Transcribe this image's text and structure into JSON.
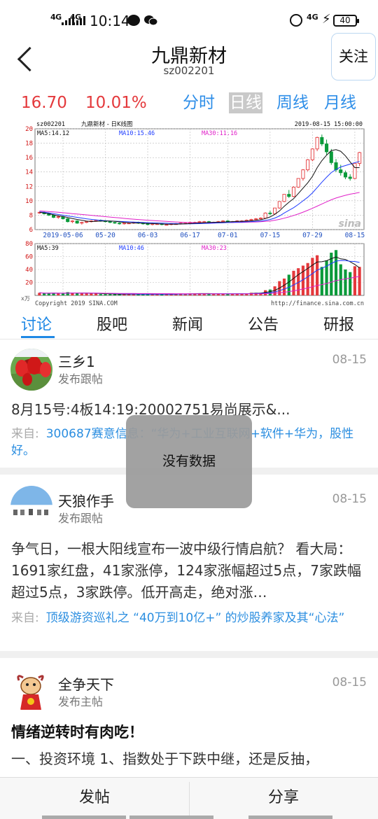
{
  "status_bar": {
    "net1": "4G",
    "net2": "4G",
    "time": "10:14",
    "net3": "4G",
    "battery": "40"
  },
  "header": {
    "title": "九鼎新材",
    "code": "sz002201",
    "follow_label": "关注"
  },
  "quote": {
    "price": "16.70",
    "change_pct": "10.01%",
    "periods": [
      "分时",
      "日线",
      "周线",
      "月线"
    ],
    "active_period": "日线"
  },
  "chart_data": {
    "type": "candlestick",
    "header_code": "sz002201",
    "header_title": "九鼎新材 - 日K线图",
    "header_time": "2019-08-15 15:00:00",
    "ma_labels": {
      "ma5": "MA5:14.12",
      "ma10": "MA10:15.46",
      "ma30": "MA30:11.16"
    },
    "price_ticks": [
      "20",
      "18",
      "16",
      "14",
      "12",
      "10",
      "8",
      "6"
    ],
    "ylim": [
      6,
      20
    ],
    "x_tick_labels": [
      "2019-05-06",
      "05-20",
      "06-03",
      "06-17",
      "07-01",
      "07-15",
      "07-29",
      "08-15"
    ],
    "watermark": "sina",
    "volume_ma_labels": {
      "ma5": "MA5:39",
      "ma10": "MA10:46",
      "ma30": "MA30:23"
    },
    "volume_ticks": [
      "80",
      "60",
      "40",
      "20"
    ],
    "volume_unit": "x万",
    "volume_ylim": [
      0,
      80
    ],
    "copyright": "Copyright 2019 SINA.COM",
    "source_url": "http://finance.sina.com.cn",
    "candles": [
      [
        8.3,
        8.5,
        8.2,
        8.4
      ],
      [
        8.4,
        8.5,
        8.1,
        8.2
      ],
      [
        8.2,
        8.3,
        7.9,
        8.0
      ],
      [
        8.0,
        8.1,
        7.6,
        7.7
      ],
      [
        7.7,
        7.9,
        7.5,
        7.8
      ],
      [
        7.8,
        7.9,
        7.4,
        7.5
      ],
      [
        7.5,
        7.6,
        7.0,
        7.1
      ],
      [
        7.1,
        7.3,
        6.9,
        7.2
      ],
      [
        7.2,
        7.3,
        6.8,
        6.9
      ],
      [
        6.9,
        7.1,
        6.7,
        7.0
      ],
      [
        7.0,
        7.2,
        6.9,
        7.1
      ],
      [
        7.1,
        7.3,
        7.0,
        7.2
      ],
      [
        7.2,
        7.4,
        7.1,
        7.3
      ],
      [
        7.3,
        7.4,
        7.1,
        7.2
      ],
      [
        7.2,
        7.3,
        7.0,
        7.1
      ],
      [
        7.1,
        7.2,
        6.9,
        7.0
      ],
      [
        7.0,
        7.1,
        6.8,
        6.9
      ],
      [
        6.9,
        7.0,
        6.7,
        6.8
      ],
      [
        6.8,
        7.0,
        6.7,
        6.9
      ],
      [
        6.9,
        7.0,
        6.8,
        6.9
      ],
      [
        6.9,
        7.1,
        6.8,
        7.0
      ],
      [
        7.0,
        7.1,
        6.8,
        6.9
      ],
      [
        6.9,
        7.0,
        6.7,
        6.8
      ],
      [
        6.8,
        6.9,
        6.6,
        6.7
      ],
      [
        6.7,
        6.9,
        6.6,
        6.8
      ],
      [
        6.8,
        6.9,
        6.7,
        6.8
      ],
      [
        6.8,
        6.9,
        6.6,
        6.7
      ],
      [
        6.7,
        6.8,
        6.6,
        6.7
      ],
      [
        6.7,
        6.9,
        6.6,
        6.8
      ],
      [
        6.8,
        6.9,
        6.7,
        6.8
      ],
      [
        6.8,
        7.0,
        6.7,
        6.9
      ],
      [
        6.9,
        7.0,
        6.8,
        6.9
      ],
      [
        6.9,
        7.1,
        6.8,
        7.0
      ],
      [
        7.0,
        7.1,
        6.9,
        7.0
      ],
      [
        7.0,
        7.2,
        6.9,
        7.1
      ],
      [
        7.1,
        7.2,
        7.0,
        7.1
      ],
      [
        7.1,
        7.2,
        6.9,
        7.0
      ],
      [
        7.0,
        7.1,
        6.9,
        7.0
      ],
      [
        7.0,
        7.2,
        6.9,
        7.1
      ],
      [
        7.1,
        7.3,
        7.0,
        7.2
      ],
      [
        7.2,
        7.3,
        7.0,
        7.1
      ],
      [
        7.1,
        7.2,
        7.0,
        7.1
      ],
      [
        7.1,
        7.3,
        7.0,
        7.2
      ],
      [
        7.2,
        7.3,
        7.1,
        7.2
      ],
      [
        7.2,
        7.4,
        7.1,
        7.3
      ],
      [
        7.3,
        7.5,
        7.2,
        7.4
      ],
      [
        7.4,
        7.6,
        7.3,
        7.5
      ],
      [
        7.5,
        7.7,
        7.4,
        7.6
      ],
      [
        7.6,
        8.4,
        7.6,
        8.3
      ],
      [
        8.3,
        8.6,
        8.0,
        8.2
      ],
      [
        8.2,
        9.0,
        8.1,
        9.0
      ],
      [
        9.0,
        9.9,
        8.9,
        9.9
      ],
      [
        9.9,
        10.9,
        9.8,
        10.9
      ],
      [
        10.9,
        11.5,
        10.4,
        10.6
      ],
      [
        10.6,
        12.0,
        10.5,
        11.9
      ],
      [
        11.9,
        13.1,
        11.8,
        13.1
      ],
      [
        13.1,
        14.4,
        12.8,
        14.3
      ],
      [
        14.3,
        15.8,
        14.1,
        15.7
      ],
      [
        15.7,
        17.3,
        15.5,
        17.2
      ],
      [
        17.2,
        18.9,
        16.9,
        18.8
      ],
      [
        18.8,
        19.2,
        17.6,
        17.9
      ],
      [
        17.9,
        18.5,
        16.4,
        16.8
      ],
      [
        16.8,
        17.2,
        15.0,
        15.3
      ],
      [
        15.3,
        15.8,
        14.0,
        14.3
      ],
      [
        14.3,
        15.0,
        13.5,
        13.9
      ],
      [
        13.9,
        14.2,
        13.0,
        13.3
      ],
      [
        13.3,
        13.7,
        12.8,
        13.1
      ],
      [
        13.1,
        15.2,
        13.0,
        15.2
      ],
      [
        15.2,
        16.8,
        14.8,
        16.7
      ]
    ],
    "volumes": [
      4,
      3,
      3,
      4,
      3,
      3,
      5,
      4,
      4,
      3,
      3,
      3,
      3,
      2,
      2,
      2,
      2,
      2,
      2,
      2,
      2,
      2,
      2,
      2,
      2,
      2,
      2,
      2,
      2,
      2,
      3,
      2,
      3,
      3,
      3,
      3,
      2,
      2,
      3,
      3,
      2,
      2,
      3,
      3,
      3,
      4,
      4,
      4,
      8,
      9,
      14,
      22,
      26,
      32,
      38,
      42,
      46,
      50,
      58,
      62,
      44,
      54,
      66,
      70,
      48,
      40,
      36,
      45,
      44
    ],
    "ma5": [
      8.4,
      8.32,
      8.2,
      8.05,
      7.92,
      7.82,
      7.68,
      7.54,
      7.41,
      7.3,
      7.18,
      7.12,
      7.15,
      7.18,
      7.2,
      7.19,
      7.16,
      7.08,
      6.99,
      6.94,
      6.92,
      6.91,
      6.88,
      6.86,
      6.84,
      6.8,
      6.78,
      6.75,
      6.75,
      6.76,
      6.78,
      6.81,
      6.84,
      6.88,
      6.92,
      6.96,
      6.99,
      7.02,
      7.03,
      7.05,
      7.08,
      7.11,
      7.14,
      7.16,
      7.18,
      7.22,
      7.28,
      7.36,
      7.54,
      7.76,
      8.12,
      8.6,
      9.24,
      9.8,
      10.3,
      11.02,
      11.76,
      12.5,
      13.4,
      14.6,
      15.58,
      16.34,
      16.98,
      17.1,
      16.88,
      16.24,
      15.4,
      14.6,
      14.6
    ],
    "ma10": [
      8.45,
      8.4,
      8.32,
      8.22,
      8.1,
      8.0,
      7.9,
      7.8,
      7.7,
      7.6,
      7.5,
      7.42,
      7.35,
      7.29,
      7.24,
      7.2,
      7.17,
      7.14,
      7.11,
      7.08,
      7.05,
      7.02,
      6.99,
      6.96,
      6.94,
      6.92,
      6.9,
      6.88,
      6.86,
      6.84,
      6.82,
      6.81,
      6.81,
      6.82,
      6.83,
      6.85,
      6.87,
      6.89,
      6.92,
      6.95,
      6.98,
      7.0,
      7.03,
      7.05,
      7.08,
      7.11,
      7.14,
      7.18,
      7.28,
      7.4,
      7.6,
      7.9,
      8.3,
      8.68,
      9.04,
      9.5,
      10.0,
      10.5,
      11.1,
      11.84,
      12.58,
      13.28,
      13.92,
      14.34,
      14.7,
      14.9,
      15.1,
      15.3,
      15.46
    ],
    "ma30": [
      8.6,
      8.55,
      8.5,
      8.45,
      8.4,
      8.34,
      8.28,
      8.22,
      8.16,
      8.1,
      8.04,
      7.98,
      7.92,
      7.86,
      7.8,
      7.74,
      7.68,
      7.62,
      7.56,
      7.5,
      7.45,
      7.4,
      7.35,
      7.3,
      7.26,
      7.22,
      7.18,
      7.14,
      7.1,
      7.06,
      7.03,
      7.0,
      6.98,
      6.96,
      6.95,
      6.94,
      6.94,
      6.94,
      6.95,
      6.96,
      6.97,
      6.98,
      6.99,
      7.0,
      7.02,
      7.04,
      7.06,
      7.09,
      7.14,
      7.2,
      7.3,
      7.42,
      7.58,
      7.76,
      7.96,
      8.18,
      8.42,
      8.68,
      8.96,
      9.26,
      9.56,
      9.86,
      10.14,
      10.38,
      10.58,
      10.76,
      10.92,
      11.04,
      11.16
    ]
  },
  "tabs": [
    "讨论",
    "股吧",
    "新闻",
    "公告",
    "研报"
  ],
  "active_tab": "讨论",
  "posts": [
    {
      "user": "三乡1",
      "type": "发布跟帖",
      "date": "08-15",
      "body": "8月15号:4板14:19:20002751易尚展示&...",
      "source_label": "来自:",
      "source_text": "300687赛意信息：“华为+工业互联网+软件+华为，股性好。"
    },
    {
      "user": "天狼作手",
      "type": "发布跟帖",
      "date": "08-15",
      "body": "争气日，一根大阳线宣布一波中级行情启航？ 看大局：1691家红盘，41家涨停，124家涨幅超过5点，7家跌幅超过5点，3家跌停。低开高走，绝对涨…",
      "source_label": "来自:",
      "source_text": "顶级游资巡礼之 “40万到10亿+” 的炒股养家及其“心法”"
    },
    {
      "user": "全争天下",
      "type": "发布主帖",
      "date": "08-15",
      "title": "情绪逆转时有肉吃！",
      "body": "一、投资环境 1、指数处于下跌中继，还是反抽，"
    }
  ],
  "toast": "没有数据",
  "bottom_bar": {
    "post_label": "发帖",
    "share_label": "分享"
  },
  "colors": {
    "up": "#e4393c",
    "down": "#0a9a3a",
    "accent": "#1e88e5",
    "ma5": "#111111",
    "ma10": "#1e3cff",
    "ma30": "#e020c8"
  }
}
